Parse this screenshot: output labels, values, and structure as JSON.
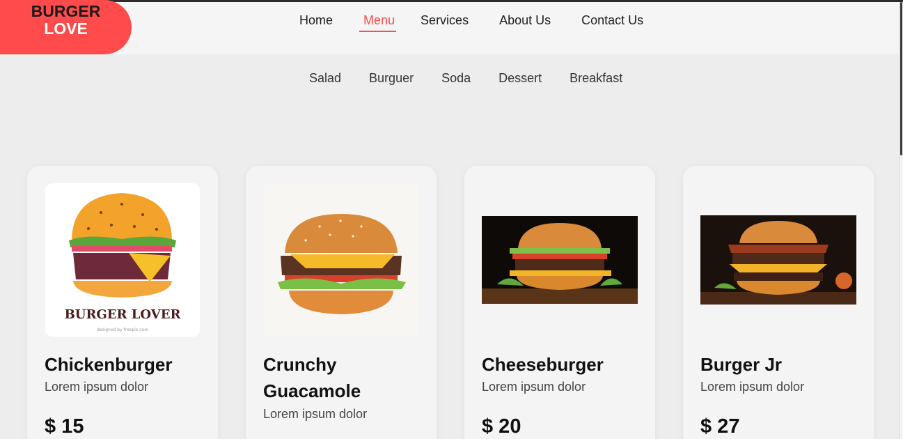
{
  "brand": {
    "line1": "BURGER",
    "line2": "LOVE"
  },
  "nav": [
    {
      "label": "Home",
      "active": false
    },
    {
      "label": "Menu",
      "active": true
    },
    {
      "label": "Services",
      "active": false
    },
    {
      "label": "About Us",
      "active": false
    },
    {
      "label": "Contact Us",
      "active": false
    }
  ],
  "categories": [
    "Salad",
    "Burguer",
    "Soda",
    "Dessert",
    "Breakfast"
  ],
  "products": [
    {
      "name": "Chickenburger",
      "description": "Lorem ipsum dolor",
      "price": "$ 15",
      "image": "illustrated-burger-lover",
      "image_text": "BURGER LOVER",
      "image_caption": "designed by freepik.com"
    },
    {
      "name": "Crunchy Guacamole",
      "description": "Lorem ipsum dolor",
      "price": "",
      "image": "photo-burger-white-bg"
    },
    {
      "name": "Cheeseburger",
      "description": "Lorem ipsum dolor",
      "price": "$ 20",
      "image": "photo-burger-dark-bg"
    },
    {
      "name": "Burger Jr",
      "description": "Lorem ipsum dolor",
      "price": "$ 27",
      "image": "photo-burger-dark-bg-2"
    }
  ],
  "colors": {
    "accent": "#ff4b4b",
    "background": "#ededed",
    "header": "#f5f5f5",
    "card": "#f4f4f4"
  }
}
